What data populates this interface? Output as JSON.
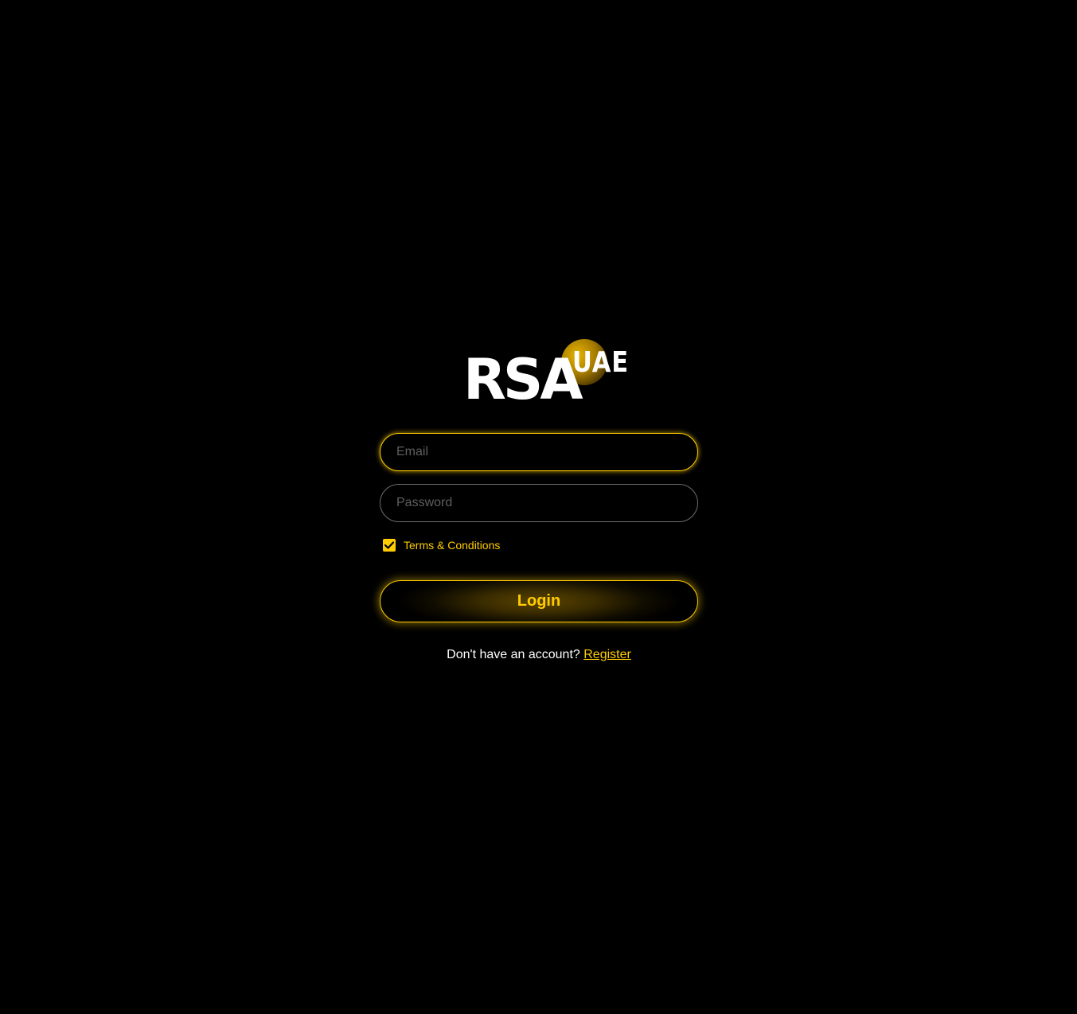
{
  "logo": {
    "main_text": "RSA",
    "badge_text": "UAE",
    "brand_color": "#ffcc00"
  },
  "form": {
    "email": {
      "placeholder": "Email",
      "value": ""
    },
    "password": {
      "placeholder": "Password",
      "value": ""
    },
    "terms": {
      "checked": true,
      "label": "Terms & Conditions"
    },
    "login_label": "Login"
  },
  "footer": {
    "prompt": "Don't have an account?",
    "register_label": "Register"
  },
  "colors": {
    "background": "#000000",
    "accent": "#ffcc00",
    "text": "#ffffff",
    "placeholder": "#5f5f5f"
  }
}
